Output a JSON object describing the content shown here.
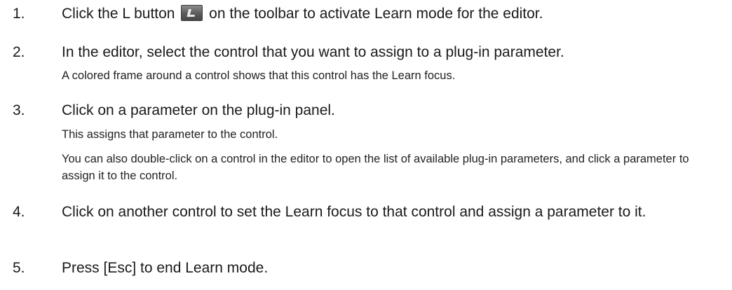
{
  "steps": [
    {
      "number": "1.",
      "text_before": "Click the L button",
      "button_icon": "learn-L-icon",
      "text_after": "on the toolbar to activate Learn mode for the editor."
    },
    {
      "number": "2.",
      "text": "In the editor, select the control that you want to assign to a plug-in parameter.",
      "notes": [
        "A colored frame around a control shows that this control has the Learn focus."
      ]
    },
    {
      "number": "3.",
      "text": "Click on a parameter on the plug-in panel.",
      "notes": [
        "This assigns that parameter to the control.",
        "You can also double-click on a control in the editor to open the list of available plug-in parameters, and click a parameter to assign it to the control."
      ]
    },
    {
      "number": "4.",
      "text": "Click on another control to set the Learn focus to that control and assign a parameter to it."
    },
    {
      "number": "5.",
      "text": "Press [Esc] to end Learn mode."
    }
  ]
}
